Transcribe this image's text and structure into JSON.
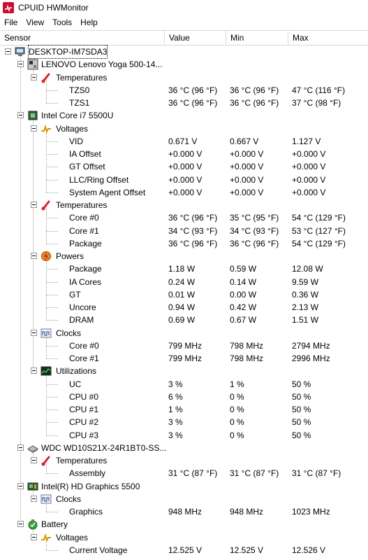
{
  "window": {
    "title": "CPUID HWMonitor"
  },
  "menu": [
    "File",
    "View",
    "Tools",
    "Help"
  ],
  "columns": [
    "Sensor",
    "Value",
    "Min",
    "Max"
  ],
  "rows": [
    {
      "level": 0,
      "kind": "computer",
      "label": "DESKTOP-IM7SDA3"
    },
    {
      "level": 1,
      "kind": "board",
      "label": "LENOVO Lenovo Yoga 500-14..."
    },
    {
      "level": 2,
      "kind": "temp",
      "label": "Temperatures"
    },
    {
      "level": 3,
      "kind": "leaf",
      "label": "TZS0",
      "value": "36 °C  (96 °F)",
      "min": "36 °C  (96 °F)",
      "max": "47 °C  (116 °F)"
    },
    {
      "level": 3,
      "kind": "leaf",
      "label": "TZS1",
      "value": "36 °C  (96 °F)",
      "min": "36 °C  (96 °F)",
      "max": "37 °C  (98 °F)"
    },
    {
      "level": 1,
      "kind": "cpu",
      "label": "Intel Core i7 5500U"
    },
    {
      "level": 2,
      "kind": "volt",
      "label": "Voltages"
    },
    {
      "level": 3,
      "kind": "leaf",
      "label": "VID",
      "value": "0.671 V",
      "min": "0.667 V",
      "max": "1.127 V"
    },
    {
      "level": 3,
      "kind": "leaf",
      "label": "IA Offset",
      "value": "+0.000 V",
      "min": "+0.000 V",
      "max": "+0.000 V"
    },
    {
      "level": 3,
      "kind": "leaf",
      "label": "GT Offset",
      "value": "+0.000 V",
      "min": "+0.000 V",
      "max": "+0.000 V"
    },
    {
      "level": 3,
      "kind": "leaf",
      "label": "LLC/Ring Offset",
      "value": "+0.000 V",
      "min": "+0.000 V",
      "max": "+0.000 V"
    },
    {
      "level": 3,
      "kind": "leaf",
      "label": "System Agent Offset",
      "value": "+0.000 V",
      "min": "+0.000 V",
      "max": "+0.000 V"
    },
    {
      "level": 2,
      "kind": "temp",
      "label": "Temperatures"
    },
    {
      "level": 3,
      "kind": "leaf",
      "label": "Core #0",
      "value": "36 °C  (96 °F)",
      "min": "35 °C  (95 °F)",
      "max": "54 °C  (129 °F)"
    },
    {
      "level": 3,
      "kind": "leaf",
      "label": "Core #1",
      "value": "34 °C  (93 °F)",
      "min": "34 °C  (93 °F)",
      "max": "53 °C  (127 °F)"
    },
    {
      "level": 3,
      "kind": "leaf",
      "label": "Package",
      "value": "36 °C  (96 °F)",
      "min": "36 °C  (96 °F)",
      "max": "54 °C  (129 °F)"
    },
    {
      "level": 2,
      "kind": "power",
      "label": "Powers"
    },
    {
      "level": 3,
      "kind": "leaf",
      "label": "Package",
      "value": "1.18 W",
      "min": "0.59 W",
      "max": "12.08 W"
    },
    {
      "level": 3,
      "kind": "leaf",
      "label": "IA Cores",
      "value": "0.24 W",
      "min": "0.14 W",
      "max": "9.59 W"
    },
    {
      "level": 3,
      "kind": "leaf",
      "label": "GT",
      "value": "0.01 W",
      "min": "0.00 W",
      "max": "0.36 W"
    },
    {
      "level": 3,
      "kind": "leaf",
      "label": "Uncore",
      "value": "0.94 W",
      "min": "0.42 W",
      "max": "2.13 W"
    },
    {
      "level": 3,
      "kind": "leaf",
      "label": "DRAM",
      "value": "0.69 W",
      "min": "0.67 W",
      "max": "1.51 W"
    },
    {
      "level": 2,
      "kind": "clock",
      "label": "Clocks"
    },
    {
      "level": 3,
      "kind": "leaf",
      "label": "Core #0",
      "value": "799 MHz",
      "min": "798 MHz",
      "max": "2794 MHz"
    },
    {
      "level": 3,
      "kind": "leaf",
      "label": "Core #1",
      "value": "799 MHz",
      "min": "798 MHz",
      "max": "2996 MHz"
    },
    {
      "level": 2,
      "kind": "util",
      "label": "Utilizations"
    },
    {
      "level": 3,
      "kind": "leaf",
      "label": "UC",
      "value": "3 %",
      "min": "1 %",
      "max": "50 %"
    },
    {
      "level": 3,
      "kind": "leaf",
      "label": "CPU #0",
      "value": "6 %",
      "min": "0 %",
      "max": "50 %"
    },
    {
      "level": 3,
      "kind": "leaf",
      "label": "CPU #1",
      "value": "1 %",
      "min": "0 %",
      "max": "50 %"
    },
    {
      "level": 3,
      "kind": "leaf",
      "label": "CPU #2",
      "value": "3 %",
      "min": "0 %",
      "max": "50 %"
    },
    {
      "level": 3,
      "kind": "leaf",
      "label": "CPU #3",
      "value": "3 %",
      "min": "0 %",
      "max": "50 %"
    },
    {
      "level": 1,
      "kind": "disk",
      "label": "WDC WD10S21X-24R1BT0-SS..."
    },
    {
      "level": 2,
      "kind": "temp",
      "label": "Temperatures"
    },
    {
      "level": 3,
      "kind": "leaf",
      "label": "Assembly",
      "value": "31 °C  (87 °F)",
      "min": "31 °C  (87 °F)",
      "max": "31 °C  (87 °F)"
    },
    {
      "level": 1,
      "kind": "gpu",
      "label": "Intel(R) HD Graphics 5500"
    },
    {
      "level": 2,
      "kind": "clock",
      "label": "Clocks"
    },
    {
      "level": 3,
      "kind": "leaf",
      "label": "Graphics",
      "value": "948 MHz",
      "min": "948 MHz",
      "max": "1023 MHz"
    },
    {
      "level": 1,
      "kind": "battery",
      "label": "Battery"
    },
    {
      "level": 2,
      "kind": "volt",
      "label": "Voltages"
    },
    {
      "level": 3,
      "kind": "leaf",
      "label": "Current Voltage",
      "value": "12.525 V",
      "min": "12.525 V",
      "max": "12.526 V"
    }
  ],
  "colors": {
    "accent": "#c8102e",
    "gridline": "#d9d9d9",
    "treeline": "#a0a0a0"
  },
  "icons": {
    "computer": "computer-icon",
    "board": "motherboard-icon",
    "cpu": "processor-icon",
    "temp": "thermometer-icon",
    "volt": "voltage-icon",
    "power": "power-icon",
    "clock": "clock-icon",
    "util": "utilization-icon",
    "disk": "disk-icon",
    "gpu": "graphics-card-icon",
    "battery": "battery-icon"
  }
}
